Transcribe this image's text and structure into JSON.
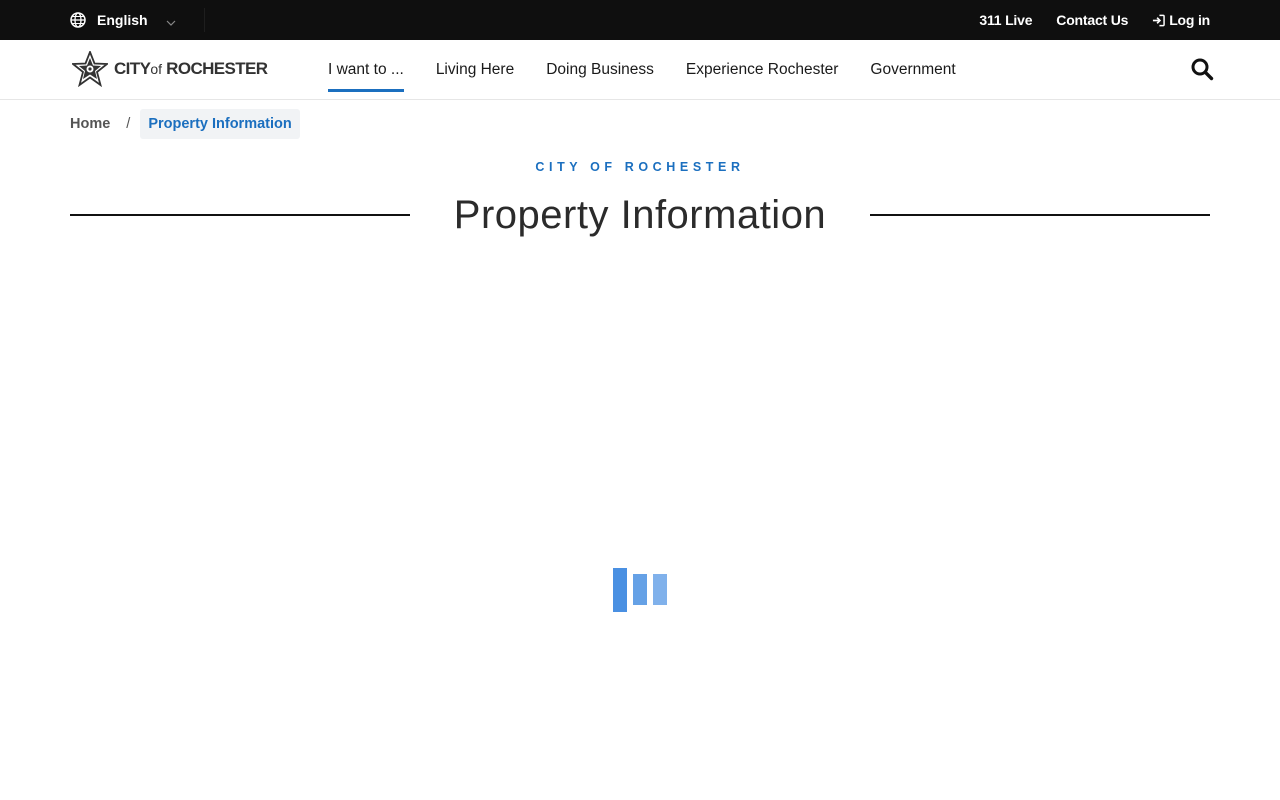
{
  "topbar": {
    "language": {
      "label": "English",
      "icon": "globe-icon",
      "chevron": "chevron-down-icon"
    },
    "links": [
      {
        "label": "311 Live"
      },
      {
        "label": "Contact Us"
      },
      {
        "label": "Log in",
        "icon": "sign-in-icon"
      }
    ]
  },
  "header": {
    "logo": {
      "main": "CITY",
      "of": "of",
      "name": "ROCHESTER",
      "icon": "lilac-star-logo-icon"
    },
    "nav": [
      {
        "label": "I want to ...",
        "active": true
      },
      {
        "label": "Living Here"
      },
      {
        "label": "Doing Business"
      },
      {
        "label": "Experience Rochester"
      },
      {
        "label": "Government"
      }
    ],
    "search_icon": "search-icon"
  },
  "breadcrumb": {
    "home": "Home",
    "separator": "/",
    "current": "Property Information"
  },
  "page": {
    "eyebrow": "CITY OF ROCHESTER",
    "title": "Property Information"
  },
  "colors": {
    "accent": "#1b6fbf",
    "topbar_bg": "#0f0f0f",
    "loader": "#4a90e2"
  }
}
